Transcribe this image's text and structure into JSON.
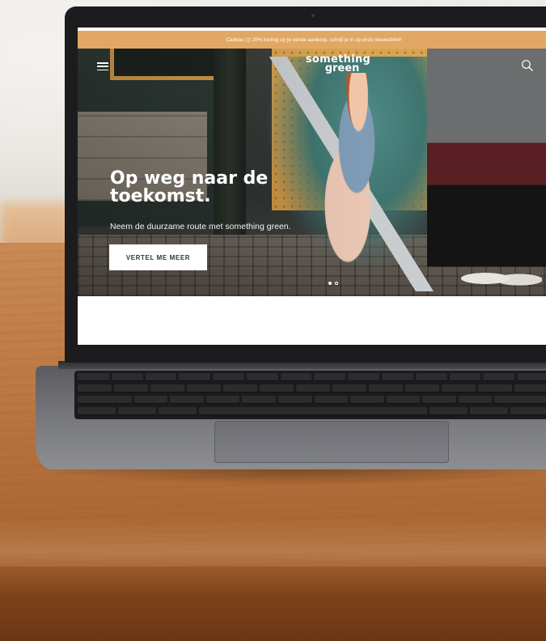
{
  "announcement": {
    "text": "Cadeau ▯▯ 20% korting op je eerste aankoop, schrijf je in op onze nieuwsbrief!"
  },
  "header": {
    "menu_icon": "hamburger-menu-icon",
    "logo_line1": "something",
    "logo_line2": "green",
    "search_icon": "search-icon"
  },
  "hero": {
    "headline_line1": "Op weg naar de",
    "headline_line2": "toekomst.",
    "subline": "Neem de duurzame route met something green.",
    "cta_label": "VERTEL ME MEER",
    "slides_total": 2,
    "slide_active": 1
  },
  "colors": {
    "announcement_bg": "#e2a863",
    "cta_bg": "#ffffff",
    "cta_text": "#2d3a3a"
  }
}
